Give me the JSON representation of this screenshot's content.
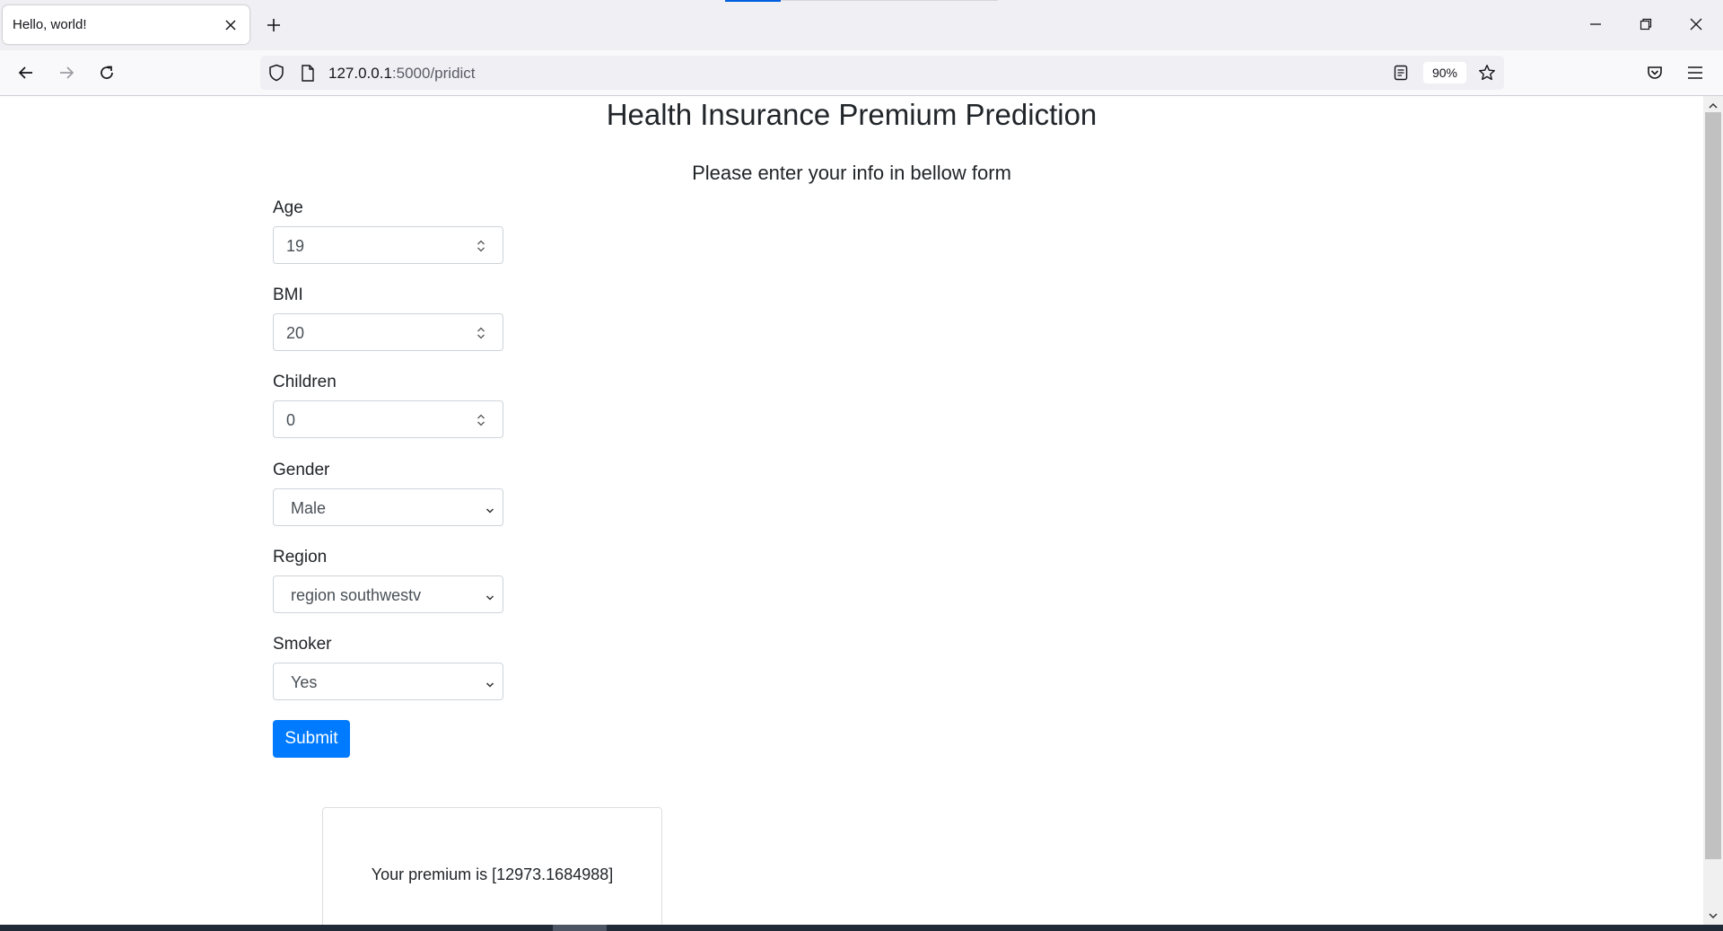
{
  "browser": {
    "tab_title": "Hello, world!",
    "url_host": "127.0.0.1",
    "url_path": ":5000/pridict",
    "zoom": "90%"
  },
  "page": {
    "title": "Health Insurance Premium Prediction",
    "subtitle": "Please enter your info in bellow form"
  },
  "form": {
    "age": {
      "label": "Age",
      "value": "19"
    },
    "bmi": {
      "label": "BMI",
      "value": "20"
    },
    "children": {
      "label": "Children",
      "value": "0"
    },
    "gender": {
      "label": "Gender",
      "selected": "Male"
    },
    "region": {
      "label": "Region",
      "selected": "region southwestv"
    },
    "smoker": {
      "label": "Smoker",
      "selected": "Yes"
    },
    "submit_label": "Submit"
  },
  "result": {
    "text": "Your premium is [12973.1684988]"
  },
  "colors": {
    "primary_button": "#007bff",
    "browser_accent": "#0060df"
  },
  "icons": [
    "close-icon",
    "plus-icon",
    "minimize-icon",
    "restore-icon",
    "back-icon",
    "forward-icon",
    "reload-icon",
    "shield-icon",
    "page-icon",
    "reader-view-icon",
    "star-icon",
    "pocket-icon",
    "menu-icon",
    "chevron-down-icon",
    "spinner-icon"
  ]
}
